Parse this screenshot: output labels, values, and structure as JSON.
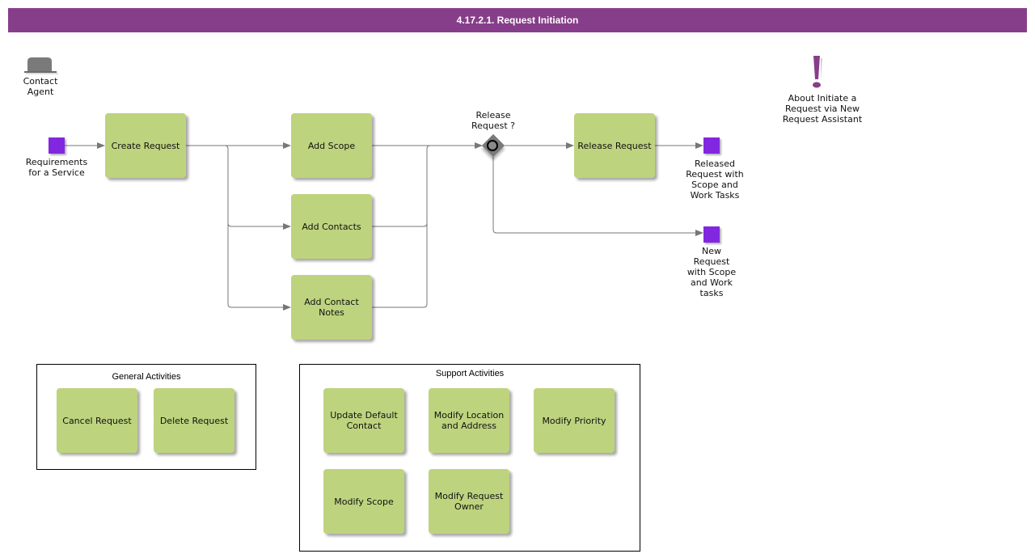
{
  "header": {
    "title": "4.17.2.1. Request Initiation"
  },
  "colors": {
    "header_bg": "#873e8a",
    "task_fill": "#bed37e",
    "event_fill": "#8227e0",
    "gateway_fill": "#7a7a7a",
    "note_icon": "#873e8a"
  },
  "actor": {
    "icon": "hat-icon",
    "label": "Contact\nAgent"
  },
  "note": {
    "icon": "exclamation-icon",
    "label": "About Initiate a\nRequest via New\nRequest Assistant"
  },
  "events": {
    "start": {
      "label": "Requirements\nfor a Service"
    },
    "end_released": {
      "label": "Released\nRequest with\nScope and\nWork Tasks"
    },
    "end_new": {
      "label": "New\nRequest\nwith Scope\nand Work\ntasks"
    }
  },
  "gateway": {
    "label": "Release\nRequest ?"
  },
  "tasks": {
    "create_request": "Create Request",
    "add_scope": "Add Scope",
    "add_contacts": "Add Contacts",
    "add_contact_notes": "Add Contact\nNotes",
    "release_request": "Release Request"
  },
  "general_activities": {
    "title": "General Activities",
    "items": [
      "Cancel Request",
      "Delete Request"
    ]
  },
  "support_activities": {
    "title": "Support Activities",
    "items": [
      "Update Default\nContact",
      "Modify Location\nand Address",
      "Modify Priority",
      "Modify Scope",
      "Modify Request\nOwner"
    ]
  }
}
